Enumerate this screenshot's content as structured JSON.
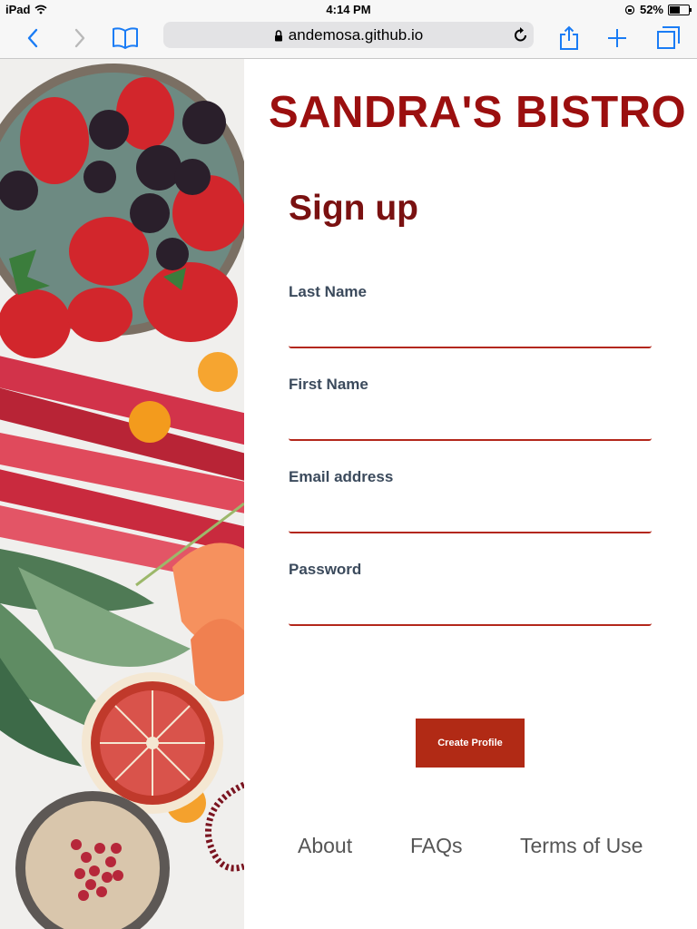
{
  "status_bar": {
    "device": "iPad",
    "time": "4:14 PM",
    "battery": "52%",
    "battery_level": 0.52
  },
  "browser": {
    "url": "andemosa.github.io",
    "icons": [
      "back-icon",
      "forward-icon",
      "bookmarks-icon",
      "lock-icon",
      "reload-icon",
      "share-icon",
      "new-tab-icon",
      "tabs-icon"
    ]
  },
  "page": {
    "brand": "SANDRA'S BISTRO",
    "title": "Sign up",
    "fields": [
      {
        "label": "Last Name",
        "value": ""
      },
      {
        "label": "First Name",
        "value": ""
      },
      {
        "label": "Email address",
        "value": ""
      },
      {
        "label": "Password",
        "value": ""
      }
    ],
    "submit_label": "Create Profile",
    "footer_links": [
      "About",
      "FAQs",
      "Terms of Use"
    ]
  },
  "colors": {
    "brand": "#9b0f0f",
    "heading": "#7a1111",
    "accent": "#b12a15",
    "label": "#3b4a5c",
    "ios_blue": "#1a7cf5"
  }
}
